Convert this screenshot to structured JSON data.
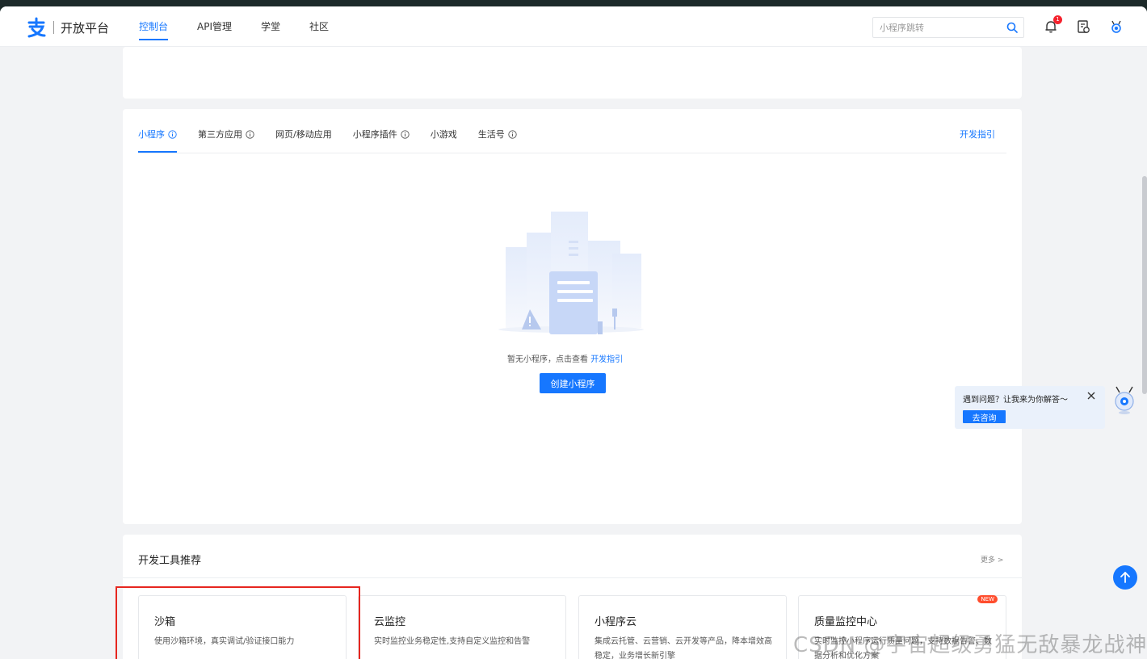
{
  "brand": {
    "name": "开放平台",
    "accent": "#1677ff"
  },
  "nav": [
    {
      "label": "控制台",
      "active": true
    },
    {
      "label": "API管理",
      "active": false
    },
    {
      "label": "学堂",
      "active": false
    },
    {
      "label": "社区",
      "active": false
    }
  ],
  "search": {
    "placeholder": "小程序跳转",
    "value": ""
  },
  "notifications": {
    "count": "1"
  },
  "app_tabs": {
    "items": [
      {
        "label": "小程序",
        "active": true,
        "has_info": true
      },
      {
        "label": "第三方应用",
        "active": false,
        "has_info": true
      },
      {
        "label": "网页/移动应用",
        "active": false,
        "has_info": false
      },
      {
        "label": "小程序插件",
        "active": false,
        "has_info": true
      },
      {
        "label": "小游戏",
        "active": false,
        "has_info": false
      },
      {
        "label": "生活号",
        "active": false,
        "has_info": true
      }
    ],
    "guide_link": "开发指引"
  },
  "empty_state": {
    "text": "暂无小程序，点击查看",
    "link": "开发指引",
    "button": "创建小程序"
  },
  "tools": {
    "title": "开发工具推荐",
    "more": "更多 >",
    "items": [
      {
        "title": "沙箱",
        "desc": "使用沙箱环境，真实调试/验证接口能力"
      },
      {
        "title": "云监控",
        "desc": "实时监控业务稳定性,支持自定义监控和告警"
      },
      {
        "title": "小程序云",
        "desc": "集成云托管、云营销、云开发等产品，降本增效高稳定，业务增长新引擎"
      },
      {
        "title": "质量监控中心",
        "desc": "实时监控小程序运行质量问题，支持数据告警、数据分析和优化方案",
        "tag": "NEW"
      }
    ]
  },
  "help": {
    "text": "遇到问题？让我来为你解答～",
    "button": "去咨询"
  },
  "watermark": "CSDN @宇宙超级勇猛无敌暴龙战神"
}
